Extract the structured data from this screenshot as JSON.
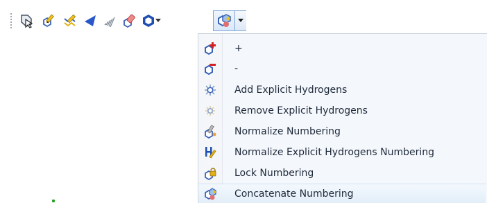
{
  "toolbar": {
    "buttons": [
      {
        "id": "select-tool",
        "icon": "select-arrow-icon"
      },
      {
        "id": "atom-edit-tool",
        "icon": "pencil-ring-icon"
      },
      {
        "id": "chain-tool",
        "icon": "chain-icon"
      },
      {
        "id": "wedge-bond-tool",
        "icon": "wedge-bond-icon"
      },
      {
        "id": "hash-bond-tool",
        "icon": "hash-bond-icon"
      },
      {
        "id": "erase-tool",
        "icon": "eraser-icon"
      },
      {
        "id": "ring-tool",
        "icon": "hexagon-ring-icon"
      },
      {
        "id": "ring-dropdown",
        "icon": "small-dropdown-arrow-icon"
      },
      {
        "id": "numbering-tool",
        "icon": "numbering-ring-icon"
      },
      {
        "id": "numbering-dropdown",
        "icon": "dropdown-arrow-icon"
      }
    ]
  },
  "menu": {
    "items": [
      {
        "label": "+",
        "icon": "add-number-icon"
      },
      {
        "label": "-",
        "icon": "remove-number-icon"
      },
      {
        "label": "Add Explicit Hydrogens",
        "icon": "add-hydrogens-icon"
      },
      {
        "label": "Remove Explicit Hydrogens",
        "icon": "remove-hydrogens-icon"
      },
      {
        "label": "Normalize Numbering",
        "icon": "normalize-numbering-icon"
      },
      {
        "label": "Normalize Explicit Hydrogens Numbering",
        "icon": "hydrogen-numbering-icon"
      },
      {
        "label": "Lock Numbering",
        "icon": "lock-numbering-icon"
      },
      {
        "label": "Concatenate Numbering",
        "icon": "concatenate-numbering-icon",
        "highlighted": true
      }
    ]
  },
  "colors": {
    "accent_border": "#7aa4d6",
    "menu_bg": "#f4f7fb",
    "hover_bg": "#e3eef9",
    "text": "#1e2a3a",
    "ring_blue": "#3a63b8",
    "plus_red": "#d42020"
  }
}
